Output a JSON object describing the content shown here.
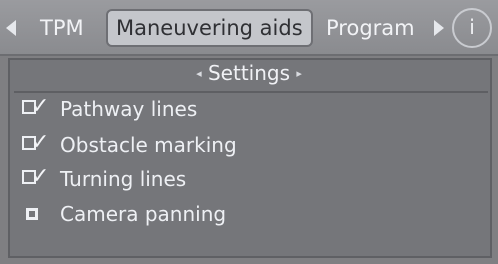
{
  "tabs": {
    "items": [
      {
        "label": "TPM"
      },
      {
        "label": "Maneuvering aids",
        "selected": true
      },
      {
        "label": "Program"
      }
    ],
    "info_label": "i"
  },
  "panel": {
    "title": "Settings",
    "options": [
      {
        "label": "Pathway lines",
        "checked": true
      },
      {
        "label": "Obstacle marking",
        "checked": true
      },
      {
        "label": "Turning lines",
        "checked": true
      },
      {
        "label": "Camera panning",
        "checked": false
      }
    ]
  },
  "colors": {
    "background": "#7f7f82",
    "tab_bar": "#8f9094",
    "selected_tab": "#c4c6cb",
    "text": "#eceef2"
  },
  "icons": {
    "tab_scroll_left": "triangle-left-icon",
    "tab_scroll_right": "triangle-right-icon",
    "info": "info-icon",
    "checked": "checkbox-checked-icon",
    "unchecked": "checkbox-unchecked-icon"
  }
}
